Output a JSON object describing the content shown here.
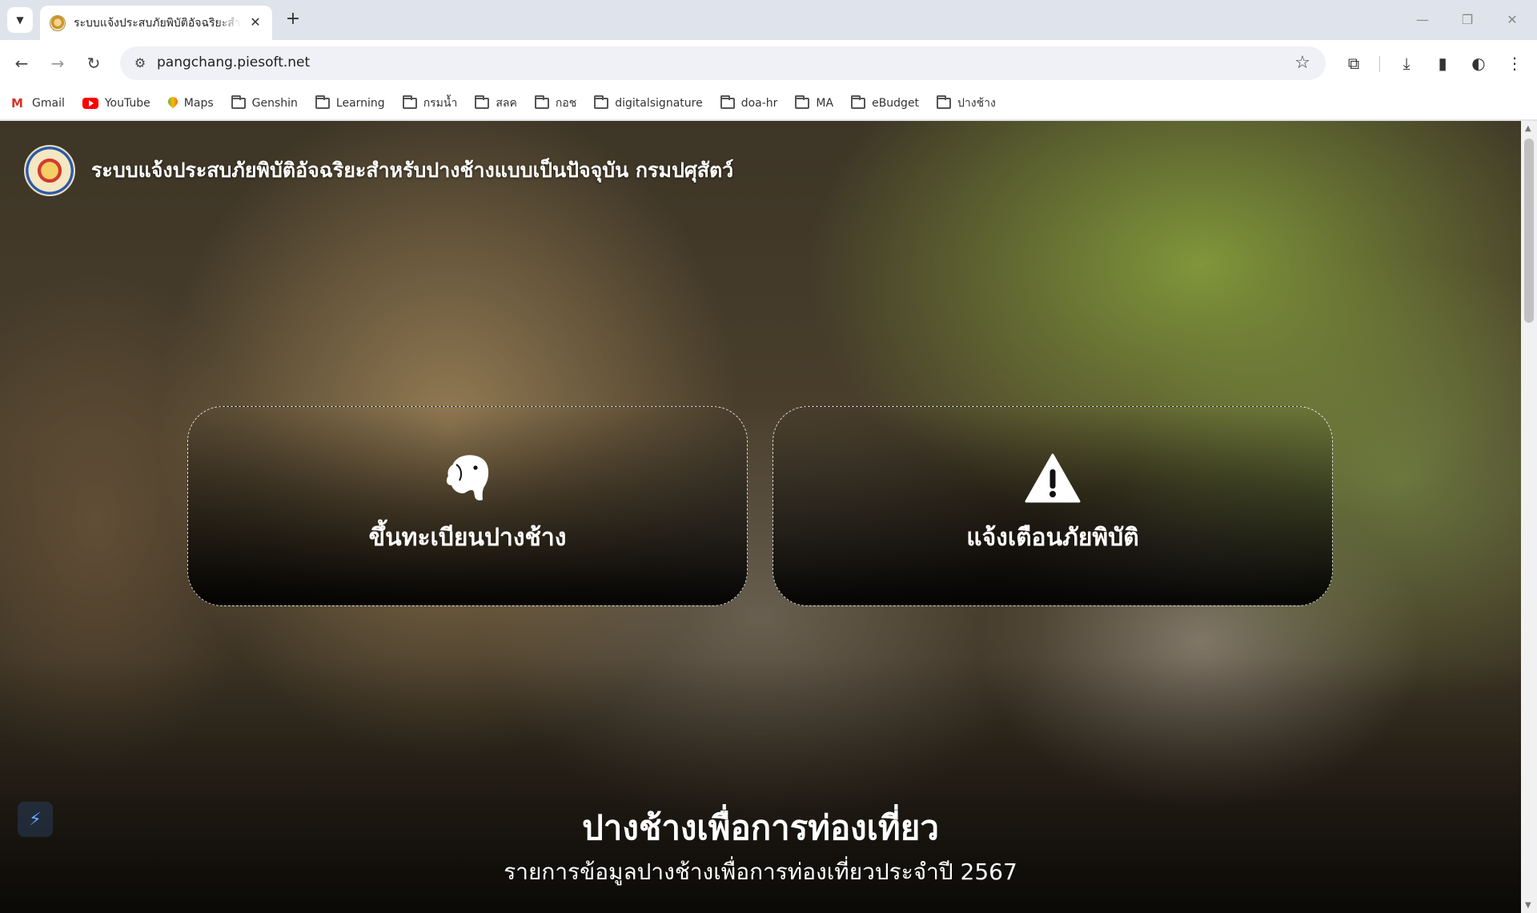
{
  "browser": {
    "tab_title": "ระบบแจ้งประสบภัยพิบัติอัจฉริยะสำหรั",
    "url": "pangchang.piesoft.net",
    "bookmarks": [
      {
        "label": "Gmail",
        "icon": "gmail-icon"
      },
      {
        "label": "YouTube",
        "icon": "youtube-icon"
      },
      {
        "label": "Maps",
        "icon": "maps-icon"
      },
      {
        "label": "Genshin",
        "icon": "folder-icon"
      },
      {
        "label": "Learning",
        "icon": "folder-icon"
      },
      {
        "label": "กรมน้ำ",
        "icon": "folder-icon"
      },
      {
        "label": "สลค",
        "icon": "folder-icon"
      },
      {
        "label": "กอช",
        "icon": "folder-icon"
      },
      {
        "label": "digitalsignature",
        "icon": "folder-icon"
      },
      {
        "label": "doa-hr",
        "icon": "folder-icon"
      },
      {
        "label": "MA",
        "icon": "folder-icon"
      },
      {
        "label": "eBudget",
        "icon": "folder-icon"
      },
      {
        "label": "ปางช้าง",
        "icon": "folder-icon"
      }
    ]
  },
  "page": {
    "title": "ระบบแจ้งประสบภัยพิบัติอัจฉริยะสำหรับปางช้างแบบเป็นปัจจุบัน กรมปศุสัตว์",
    "cards": {
      "register_label": "ขึ้นทะเบียนปางช้าง",
      "alert_label": "แจ้งเตือนภัยพิบัติ"
    },
    "section_title": "ปางช้างเพื่อการท่องเที่ยว",
    "section_subtitle": "รายการข้อมูลปางช้างเพื่อการท่องเที่ยวประจำปี 2567"
  }
}
